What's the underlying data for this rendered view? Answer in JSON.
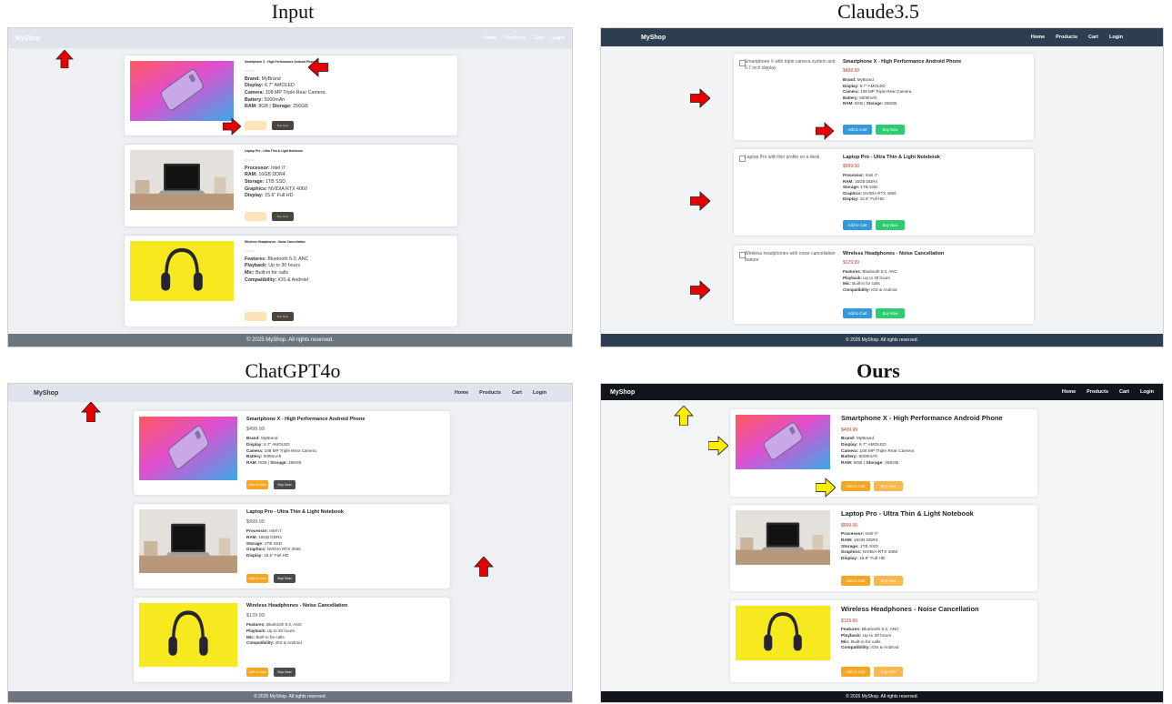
{
  "captions": {
    "input": "Input",
    "claude": "Claude3.5",
    "chatgpt": "ChatGPT4o",
    "ours": "Ours"
  },
  "shop": {
    "brand": "MyShop",
    "nav": [
      "Home",
      "Products",
      "Cart",
      "Login"
    ],
    "footer": "© 2025 MyShop. All rights reserved.",
    "add_to_cart": "Add to Cart",
    "buy_now": "Buy Now"
  },
  "products": [
    {
      "name": "Smartphone X - High Performance Android Phone",
      "price": "$499.99",
      "alt": "Smartphone X with triple camera system and 6.7 inch display",
      "specs": [
        {
          "label": "Brand:",
          "value": "MyBrand"
        },
        {
          "label": "Display:",
          "value": "6.7\" AMOLED"
        },
        {
          "label": "Camera:",
          "value": "108 MP Triple Rear Camera"
        },
        {
          "label": "Battery:",
          "value": "5000mAh"
        },
        {
          "label": "RAM:",
          "value": "8GB"
        },
        {
          "label": "Storage:",
          "value": "256GB"
        }
      ]
    },
    {
      "name": "Laptop Pro - Ultra Thin & Light Notebook",
      "price": "$999.00",
      "alt": "Laptop Pro with thin profile on a desk",
      "specs": [
        {
          "label": "Processor:",
          "value": "Intel i7"
        },
        {
          "label": "RAM:",
          "value": "16GB DDR4"
        },
        {
          "label": "Storage:",
          "value": "1TB SSD"
        },
        {
          "label": "Graphics:",
          "value": "NVIDIA RTX 4060"
        },
        {
          "label": "Display:",
          "value": "15.6\" Full HD"
        }
      ]
    },
    {
      "name": "Wireless Headphones - Noise Cancellation",
      "price": "$129.99",
      "alt": "Wireless headphones with noise cancellation feature",
      "specs": [
        {
          "label": "Features:",
          "value": "Bluetooth 5.0, ANC"
        },
        {
          "label": "Playback:",
          "value": "Up to 30 hours"
        },
        {
          "label": "Mic:",
          "value": "Built-in for calls"
        },
        {
          "label": "Compatibility:",
          "value": "iOS & Android"
        }
      ]
    }
  ],
  "colors": {
    "red_arrow": "#e60000",
    "yellow_arrow": "#ffee00",
    "orange_button": "#f5a623",
    "dark_button": "#4a4a4a",
    "blue_button": "#3498db",
    "green_button": "#2ecc71"
  }
}
